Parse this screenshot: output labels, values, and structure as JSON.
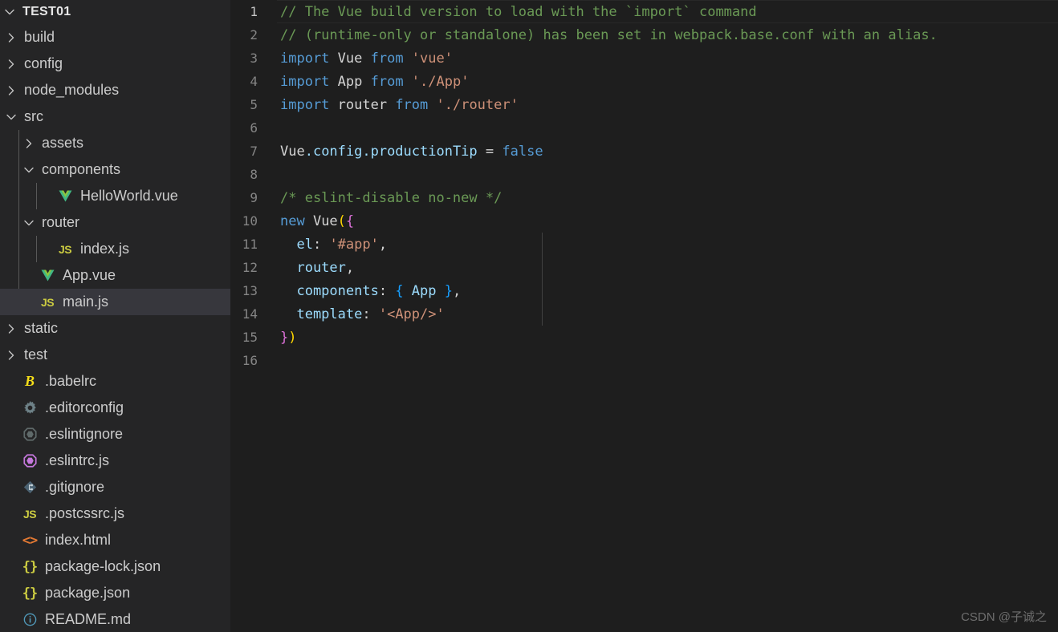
{
  "sidebar": {
    "root_label": "TEST01",
    "items": [
      {
        "label": "build",
        "icon": "folder",
        "depth": 1,
        "twisty": "collapsed",
        "selected": false
      },
      {
        "label": "config",
        "icon": "folder",
        "depth": 1,
        "twisty": "collapsed",
        "selected": false
      },
      {
        "label": "node_modules",
        "icon": "folder",
        "depth": 1,
        "twisty": "collapsed",
        "selected": false
      },
      {
        "label": "src",
        "icon": "folder",
        "depth": 1,
        "twisty": "expanded",
        "selected": false
      },
      {
        "label": "assets",
        "icon": "folder",
        "depth": 2,
        "twisty": "collapsed",
        "selected": false
      },
      {
        "label": "components",
        "icon": "folder",
        "depth": 2,
        "twisty": "expanded",
        "selected": false
      },
      {
        "label": "HelloWorld.vue",
        "icon": "vue-icon",
        "depth": 3,
        "twisty": "none",
        "selected": false
      },
      {
        "label": "router",
        "icon": "folder",
        "depth": 2,
        "twisty": "expanded",
        "selected": false
      },
      {
        "label": "index.js",
        "icon": "js-icon",
        "depth": 3,
        "twisty": "none",
        "selected": false
      },
      {
        "label": "App.vue",
        "icon": "vue-icon",
        "depth": 2,
        "twisty": "none",
        "selected": false
      },
      {
        "label": "main.js",
        "icon": "js-icon",
        "depth": 2,
        "twisty": "none",
        "selected": true
      },
      {
        "label": "static",
        "icon": "folder",
        "depth": 1,
        "twisty": "collapsed",
        "selected": false
      },
      {
        "label": "test",
        "icon": "folder",
        "depth": 1,
        "twisty": "collapsed",
        "selected": false
      },
      {
        "label": ".babelrc",
        "icon": "babel-icon",
        "depth": 1,
        "twisty": "none",
        "selected": false
      },
      {
        "label": ".editorconfig",
        "icon": "gear-icon",
        "depth": 1,
        "twisty": "none",
        "selected": false
      },
      {
        "label": ".eslintignore",
        "icon": "eslint-ignore-icon",
        "depth": 1,
        "twisty": "none",
        "selected": false
      },
      {
        "label": ".eslintrc.js",
        "icon": "eslint-icon",
        "depth": 1,
        "twisty": "none",
        "selected": false
      },
      {
        "label": ".gitignore",
        "icon": "git-icon",
        "depth": 1,
        "twisty": "none",
        "selected": false
      },
      {
        "label": ".postcssrc.js",
        "icon": "js-icon",
        "depth": 1,
        "twisty": "none",
        "selected": false
      },
      {
        "label": "index.html",
        "icon": "html-icon",
        "depth": 1,
        "twisty": "none",
        "selected": false
      },
      {
        "label": "package-lock.json",
        "icon": "json-icon",
        "depth": 1,
        "twisty": "none",
        "selected": false
      },
      {
        "label": "package.json",
        "icon": "json-icon",
        "depth": 1,
        "twisty": "none",
        "selected": false
      },
      {
        "label": "README.md",
        "icon": "info-icon",
        "depth": 1,
        "twisty": "none",
        "selected": false
      }
    ]
  },
  "editor": {
    "active_line": 1,
    "lines": [
      {
        "n": 1,
        "tokens": [
          {
            "t": "// The Vue build version to load with the `import` command",
            "c": "t-com"
          }
        ]
      },
      {
        "n": 2,
        "tokens": [
          {
            "t": "// (runtime-only or standalone) has been set in webpack.base.conf with an alias.",
            "c": "t-com"
          }
        ]
      },
      {
        "n": 3,
        "tokens": [
          {
            "t": "import ",
            "c": "t-kw"
          },
          {
            "t": "Vue ",
            "c": "t-id"
          },
          {
            "t": "from ",
            "c": "t-kw"
          },
          {
            "t": "'vue'",
            "c": "t-str"
          }
        ]
      },
      {
        "n": 4,
        "tokens": [
          {
            "t": "import ",
            "c": "t-kw"
          },
          {
            "t": "App ",
            "c": "t-id"
          },
          {
            "t": "from ",
            "c": "t-kw"
          },
          {
            "t": "'./App'",
            "c": "t-str"
          }
        ]
      },
      {
        "n": 5,
        "tokens": [
          {
            "t": "import ",
            "c": "t-kw"
          },
          {
            "t": "router ",
            "c": "t-id"
          },
          {
            "t": "from ",
            "c": "t-kw"
          },
          {
            "t": "'./router'",
            "c": "t-str"
          }
        ]
      },
      {
        "n": 6,
        "tokens": []
      },
      {
        "n": 7,
        "tokens": [
          {
            "t": "Vue",
            "c": "t-id"
          },
          {
            "t": ".config.productionTip ",
            "c": "t-prop"
          },
          {
            "t": "= ",
            "c": "t-id"
          },
          {
            "t": "false",
            "c": "t-const"
          }
        ]
      },
      {
        "n": 8,
        "tokens": []
      },
      {
        "n": 9,
        "tokens": [
          {
            "t": "/* eslint-disable no-new */",
            "c": "t-com"
          }
        ]
      },
      {
        "n": 10,
        "tokens": [
          {
            "t": "new ",
            "c": "t-kw"
          },
          {
            "t": "Vue",
            "c": "t-id"
          },
          {
            "t": "(",
            "c": "b-y"
          },
          {
            "t": "{",
            "c": "b-p"
          }
        ]
      },
      {
        "n": 11,
        "tokens": [
          {
            "t": "  el",
            "c": "t-prop"
          },
          {
            "t": ": ",
            "c": "t-id"
          },
          {
            "t": "'#app'",
            "c": "t-str"
          },
          {
            "t": ",",
            "c": "t-id"
          }
        ]
      },
      {
        "n": 12,
        "tokens": [
          {
            "t": "  router",
            "c": "t-prop"
          },
          {
            "t": ",",
            "c": "t-id"
          }
        ]
      },
      {
        "n": 13,
        "tokens": [
          {
            "t": "  components",
            "c": "t-prop"
          },
          {
            "t": ": ",
            "c": "t-id"
          },
          {
            "t": "{",
            "c": "b-b"
          },
          {
            "t": " App ",
            "c": "t-prop"
          },
          {
            "t": "}",
            "c": "b-b"
          },
          {
            "t": ",",
            "c": "t-id"
          }
        ]
      },
      {
        "n": 14,
        "tokens": [
          {
            "t": "  template",
            "c": "t-prop"
          },
          {
            "t": ": ",
            "c": "t-id"
          },
          {
            "t": "'<App/>'",
            "c": "t-str"
          }
        ]
      },
      {
        "n": 15,
        "tokens": [
          {
            "t": "}",
            "c": "b-p"
          },
          {
            "t": ")",
            "c": "b-y"
          }
        ]
      },
      {
        "n": 16,
        "tokens": []
      }
    ]
  },
  "watermark": {
    "text": "CSDN @子诚之"
  },
  "colors": {
    "sidebar_bg": "#252526",
    "editor_bg": "#1e1e1e",
    "selected_row_bg": "#37373d",
    "comment": "#6a9955",
    "keyword": "#569cd6",
    "string": "#ce9178",
    "property": "#9cdcfe",
    "bracket_yellow": "#ffd700",
    "bracket_pink": "#da70d6",
    "bracket_blue": "#179fff"
  }
}
